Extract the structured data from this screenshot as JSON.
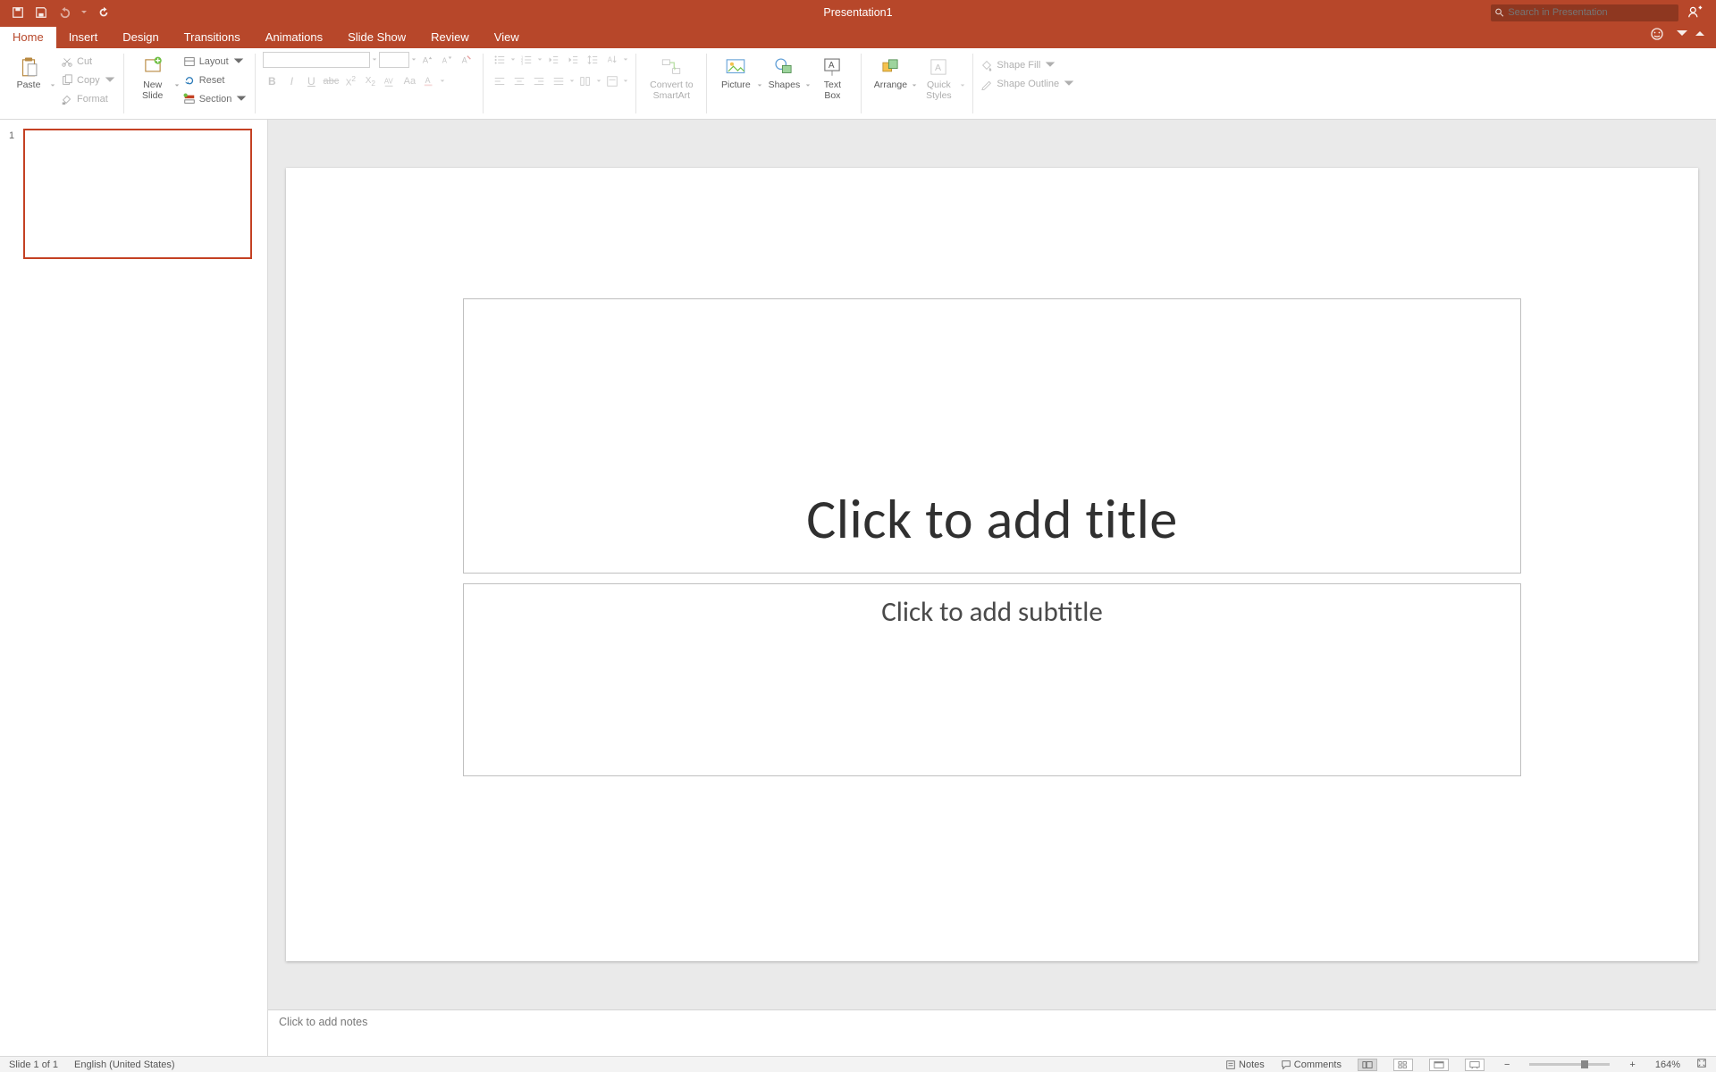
{
  "titlebar": {
    "doc_title": "Presentation1",
    "search_placeholder": "Search in Presentation"
  },
  "tabs": [
    "Home",
    "Insert",
    "Design",
    "Transitions",
    "Animations",
    "Slide Show",
    "Review",
    "View"
  ],
  "active_tab": "Home",
  "ribbon": {
    "paste": "Paste",
    "cut": "Cut",
    "copy": "Copy",
    "format": "Format",
    "new_slide": "New\nSlide",
    "layout": "Layout",
    "reset": "Reset",
    "section": "Section",
    "convert_smartart": "Convert to\nSmartArt",
    "picture": "Picture",
    "shapes": "Shapes",
    "text_box": "Text\nBox",
    "arrange": "Arrange",
    "quick_styles": "Quick\nStyles",
    "shape_fill": "Shape Fill",
    "shape_outline": "Shape Outline"
  },
  "slide_panel": {
    "thumb_number": "1"
  },
  "canvas": {
    "title_placeholder": "Click to add title",
    "subtitle_placeholder": "Click to add subtitle"
  },
  "notes": {
    "placeholder": "Click to add notes"
  },
  "statusbar": {
    "slide_count": "Slide 1 of 1",
    "language": "English (United States)",
    "notes": "Notes",
    "comments": "Comments",
    "zoom": "164%"
  }
}
